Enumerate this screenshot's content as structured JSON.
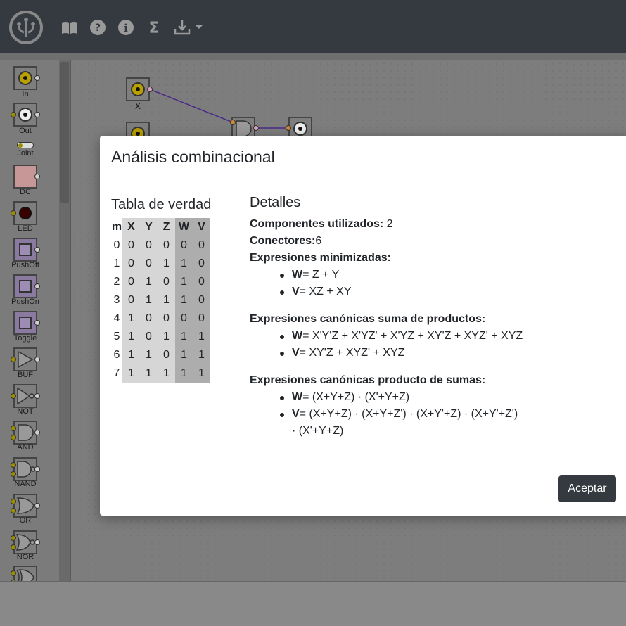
{
  "navbar": {
    "icons": [
      "logo-icon",
      "book-icon",
      "help-icon",
      "info-icon",
      "sigma-icon",
      "download-icon",
      "caret-down-icon"
    ]
  },
  "palette": {
    "items": [
      {
        "label": "In"
      },
      {
        "label": "Out"
      },
      {
        "label": "Joint"
      },
      {
        "label": "DC"
      },
      {
        "label": "LED"
      },
      {
        "label": "PushOff"
      },
      {
        "label": "PushOn"
      },
      {
        "label": "Toggle"
      },
      {
        "label": "BUF"
      },
      {
        "label": "NOT"
      },
      {
        "label": "AND"
      },
      {
        "label": "NAND"
      },
      {
        "label": "OR"
      },
      {
        "label": "NOR"
      }
    ]
  },
  "canvas": {
    "input_x_label": "X"
  },
  "modal": {
    "title": "Análisis combinacional",
    "truth_table": {
      "title": "Tabla de verdad",
      "headers": [
        "m",
        "X",
        "Y",
        "Z",
        "W",
        "V"
      ],
      "rows": [
        [
          "0",
          "0",
          "0",
          "0",
          "0",
          "0"
        ],
        [
          "1",
          "0",
          "0",
          "1",
          "1",
          "0"
        ],
        [
          "2",
          "0",
          "1",
          "0",
          "1",
          "0"
        ],
        [
          "3",
          "0",
          "1",
          "1",
          "1",
          "0"
        ],
        [
          "4",
          "1",
          "0",
          "0",
          "0",
          "0"
        ],
        [
          "5",
          "1",
          "0",
          "1",
          "1",
          "1"
        ],
        [
          "6",
          "1",
          "1",
          "0",
          "1",
          "1"
        ],
        [
          "7",
          "1",
          "1",
          "1",
          "1",
          "1"
        ]
      ]
    },
    "details": {
      "title": "Detalles",
      "components_label": "Componentes utilizados:",
      "components_value": " 2",
      "connectors_label": "Conectores:",
      "connectors_value": "6",
      "minimized_label": "Expresiones minimizadas:",
      "minimized": [
        {
          "var": "W",
          "expr": "= Z + Y"
        },
        {
          "var": "V",
          "expr": "= XZ + XY"
        }
      ],
      "sop_label": "Expresiones canónicas suma de productos:",
      "sop": [
        {
          "var": "W",
          "expr": "= X'Y'Z + X'YZ' + X'YZ + XY'Z + XYZ' + XYZ"
        },
        {
          "var": "V",
          "expr": "= XY'Z + XYZ' + XYZ"
        }
      ],
      "pos_label": "Expresiones canónicas producto de sumas:",
      "pos": [
        {
          "var": "W",
          "expr": "= (X+Y+Z) · (X'+Y+Z)"
        },
        {
          "var": "V",
          "expr": "= (X+Y+Z) · (X+Y+Z') · (X+Y'+Z) · (X+Y'+Z')",
          "cont": "· (X'+Y+Z)"
        }
      ]
    },
    "accept_label": "Aceptar"
  }
}
